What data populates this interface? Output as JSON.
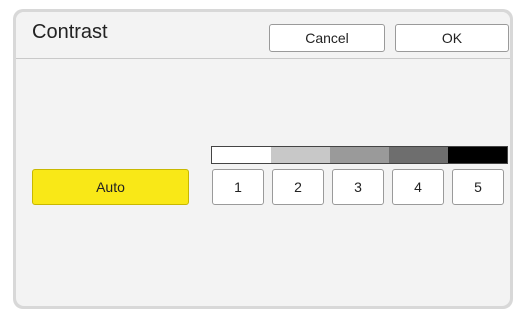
{
  "dialog": {
    "title": "Contrast",
    "cancel_label": "Cancel",
    "ok_label": "OK"
  },
  "auto_button": {
    "label": "Auto",
    "color": "#f9e817"
  },
  "contrast_scale": {
    "swatches": [
      "#ffffff",
      "#c8c8c8",
      "#9a9a9a",
      "#6e6e6e",
      "#000000"
    ]
  },
  "levels": [
    {
      "label": "1"
    },
    {
      "label": "2"
    },
    {
      "label": "3"
    },
    {
      "label": "4"
    },
    {
      "label": "5"
    }
  ]
}
